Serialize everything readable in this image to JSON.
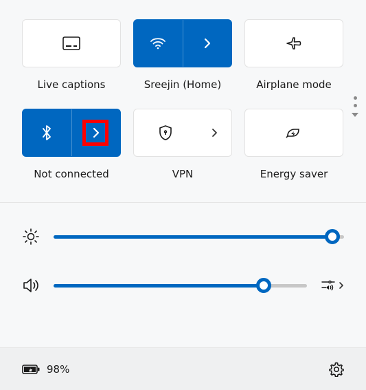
{
  "tiles": {
    "live_captions": {
      "label": "Live captions"
    },
    "wifi": {
      "label": "Sreejin (Home)"
    },
    "airplane": {
      "label": "Airplane mode"
    },
    "bluetooth": {
      "label": "Not connected"
    },
    "vpn": {
      "label": "VPN"
    },
    "energy": {
      "label": "Energy saver"
    }
  },
  "sliders": {
    "brightness": {
      "value": 96
    },
    "volume": {
      "value": 83
    }
  },
  "battery": {
    "percent_label": "98%"
  },
  "colors": {
    "accent": "#0067c0"
  },
  "highlight": {
    "target": "bluetooth-expand"
  }
}
